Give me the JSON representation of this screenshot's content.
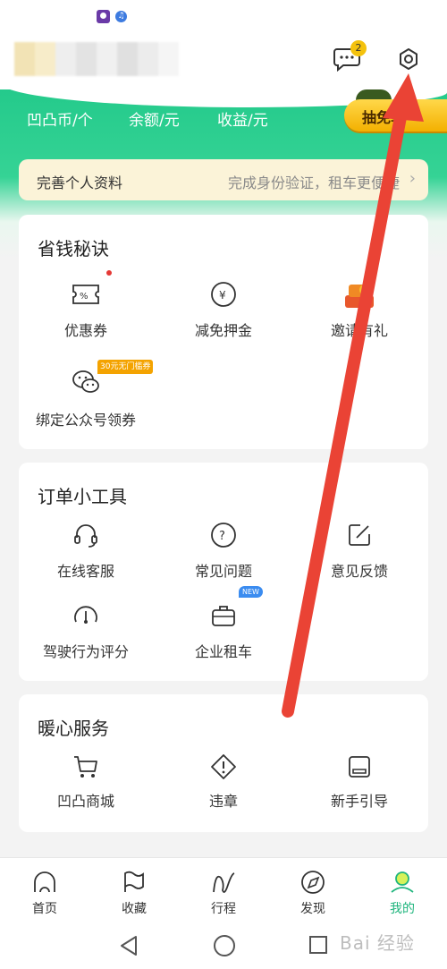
{
  "colors": {
    "brand_green": "#22c98a",
    "accent_yellow": "#f4c20d",
    "arrow_red": "#ea4335"
  },
  "status_bar": {
    "icons": [
      "app-notification-icon",
      "music-icon"
    ]
  },
  "header": {
    "message_badge": "2",
    "icons": [
      "chat-icon",
      "gear-icon"
    ]
  },
  "stats": {
    "items": [
      "凹凸币/个",
      "余额/元",
      "收益/元"
    ]
  },
  "lottery": {
    "label": "抽免单"
  },
  "profile_card": {
    "title": "完善个人资料",
    "hint": "完成身份验证，租车更便捷"
  },
  "sections": {
    "saving": {
      "title": "省钱秘诀",
      "items": [
        {
          "label": "优惠券",
          "icon": "coupon-icon"
        },
        {
          "label": "减免押金",
          "icon": "yuan-coin-icon"
        },
        {
          "label": "邀请有礼",
          "icon": "gift-stack-icon"
        },
        {
          "label": "绑定公众号领券",
          "icon": "wechat-icon",
          "tag": "30元无门槛券"
        }
      ]
    },
    "tools": {
      "title": "订单小工具",
      "items": [
        {
          "label": "在线客服",
          "icon": "headset-icon"
        },
        {
          "label": "常见问题",
          "icon": "question-icon"
        },
        {
          "label": "意见反馈",
          "icon": "edit-icon"
        },
        {
          "label": "驾驶行为评分",
          "icon": "speedometer-icon"
        },
        {
          "label": "企业租车",
          "icon": "briefcase-icon",
          "tag": "NEW"
        }
      ]
    },
    "services": {
      "title": "暖心服务",
      "items": [
        {
          "label": "凹凸商城",
          "icon": "cart-icon"
        },
        {
          "label": "违章",
          "icon": "warning-diamond-icon"
        },
        {
          "label": "新手引导",
          "icon": "guide-icon"
        }
      ]
    }
  },
  "bottom_nav": {
    "items": [
      {
        "label": "首页",
        "icon": "home-icon"
      },
      {
        "label": "收藏",
        "icon": "flag-icon"
      },
      {
        "label": "行程",
        "icon": "route-icon"
      },
      {
        "label": "发现",
        "icon": "compass-icon"
      },
      {
        "label": "我的",
        "icon": "profile-icon",
        "active": true
      }
    ]
  },
  "system_nav": {
    "icons": [
      "back-icon",
      "home-circle-icon",
      "recent-apps-icon"
    ]
  },
  "watermark": {
    "text": "Bai 经验"
  }
}
